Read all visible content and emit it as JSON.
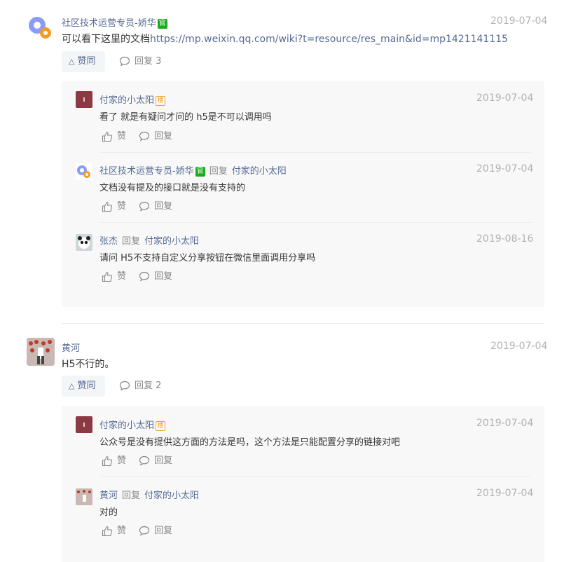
{
  "threads": [
    {
      "author": "社区技术运营专员-娇华",
      "badge": "官",
      "date": "2019-07-04",
      "text_prefix": "可以看下这里的文档",
      "link": "https://mp.weixin.qq.com/wiki?t=resource/res_main&id=mp1421141115",
      "like_label": "赞同",
      "reply_label": "回复 3",
      "replies": [
        {
          "author": "付家的小太阳",
          "badge": "楼",
          "reply_word": "",
          "reply_to": "",
          "date": "2019-07-04",
          "text": "看了  就是有疑问才问的  h5是不可以调用吗",
          "like": "赞",
          "reply": "回复"
        },
        {
          "author": "社区技术运营专员-娇华",
          "badge": "官",
          "reply_word": "回复",
          "reply_to": "付家的小太阳",
          "date": "2019-07-04",
          "text": "文档没有提及的接口就是没有支持的",
          "like": "赞",
          "reply": "回复"
        },
        {
          "author": "张杰",
          "badge": "",
          "reply_word": "回复",
          "reply_to": "付家的小太阳",
          "date": "2019-08-16",
          "text": "请问 H5不支持自定义分享按钮在微信里面调用分享吗",
          "like": "赞",
          "reply": "回复"
        }
      ]
    },
    {
      "author": "黄河",
      "badge": "",
      "date": "2019-07-04",
      "text_prefix": "H5不行的。",
      "link": "",
      "like_label": "赞同",
      "reply_label": "回复 2",
      "replies": [
        {
          "author": "付家的小太阳",
          "badge": "楼",
          "reply_word": "",
          "reply_to": "",
          "date": "2019-07-04",
          "text": "公众号是没有提供这方面的方法是吗，这个方法是只能配置分享的链接对吧",
          "like": "赞",
          "reply": "回复"
        },
        {
          "author": "黄河",
          "badge": "",
          "reply_word": "回复",
          "reply_to": "付家的小太阳",
          "date": "2019-07-04",
          "text": "对的",
          "like": "赞",
          "reply": "回复"
        }
      ]
    }
  ]
}
